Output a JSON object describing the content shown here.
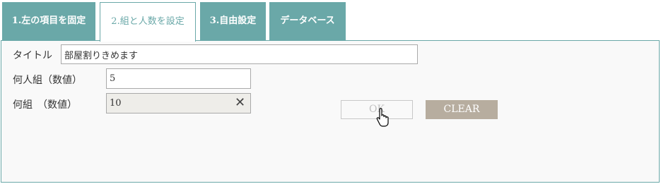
{
  "tabs": [
    {
      "label": "1.左の項目を固定",
      "active": false
    },
    {
      "label": "2.組と人数を設定",
      "active": true
    },
    {
      "label": "3.自由設定",
      "active": false
    },
    {
      "label": "データベース",
      "active": false
    }
  ],
  "form": {
    "title_label": "タイトル",
    "title_value": "部屋割りきめます",
    "people_label": "何人組（数値）",
    "people_value": "5",
    "groups_label": "何組　（数値）",
    "groups_value": "10",
    "clear_x_glyph": "✕"
  },
  "buttons": {
    "ok_label": "OK",
    "clear_label": "CLEAR"
  },
  "colors": {
    "accent": "#6aa8a8",
    "clear_button": "#b7ad9f",
    "readonly_field": "#eeede9"
  },
  "icons": {
    "cursor": "hand-pointer-icon"
  }
}
